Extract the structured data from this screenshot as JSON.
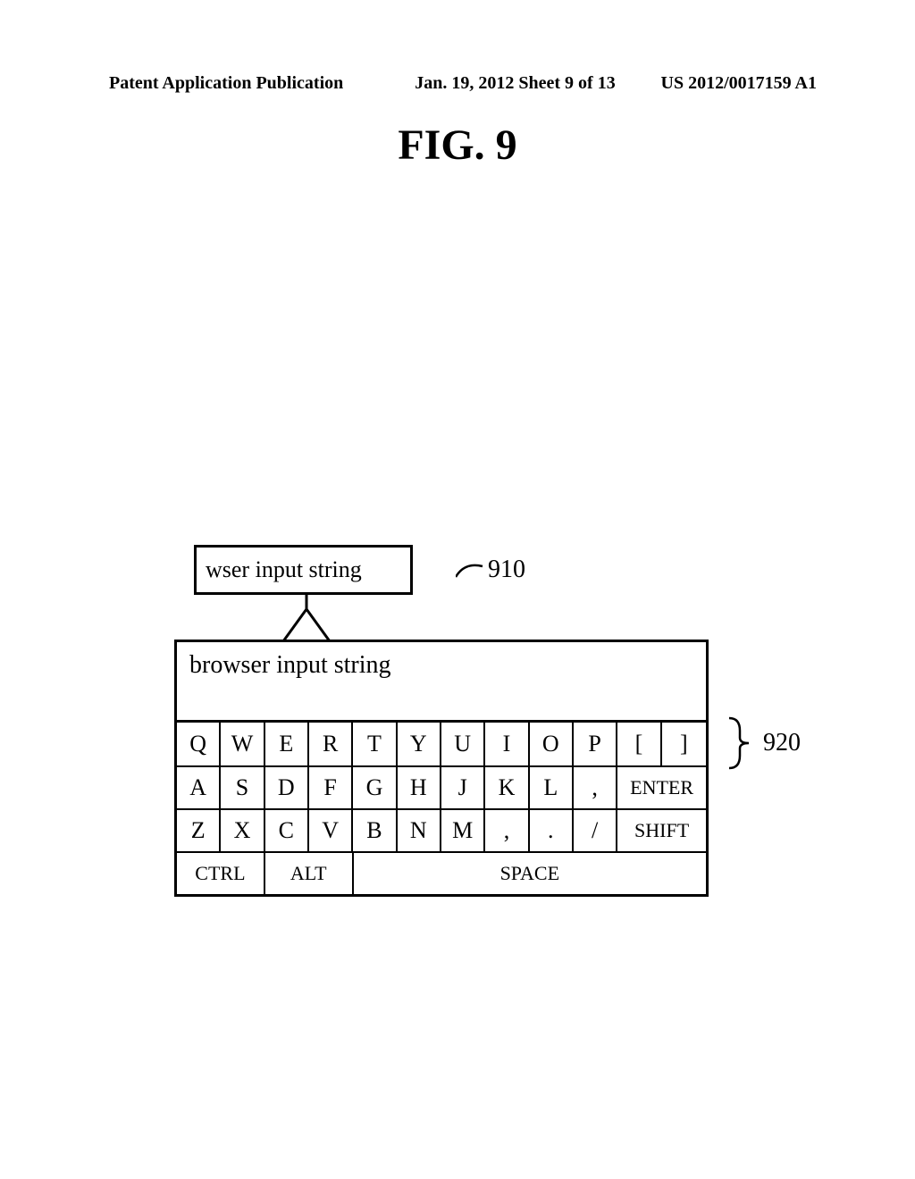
{
  "header": {
    "left": "Patent Application Publication",
    "mid": "Jan. 19, 2012  Sheet 9 of 13",
    "right": "US 2012/0017159 A1"
  },
  "figure_title": "FIG. 9",
  "popup_text": "wser input string",
  "ref_910": "910",
  "osk_input_text": "browser input string",
  "ref_920": "920",
  "kb": {
    "row1": [
      "Q",
      "W",
      "E",
      "R",
      "T",
      "Y",
      "U",
      "I",
      "O",
      "P",
      "[",
      "]"
    ],
    "row2": [
      "A",
      "S",
      "D",
      "F",
      "G",
      "H",
      "J",
      "K",
      "L",
      ",",
      "ENTER"
    ],
    "row3": [
      "Z",
      "X",
      "C",
      "V",
      "B",
      "N",
      "M",
      ",",
      ".",
      "/",
      "SHIFT"
    ],
    "row4": [
      "CTRL",
      "ALT",
      "SPACE"
    ]
  }
}
